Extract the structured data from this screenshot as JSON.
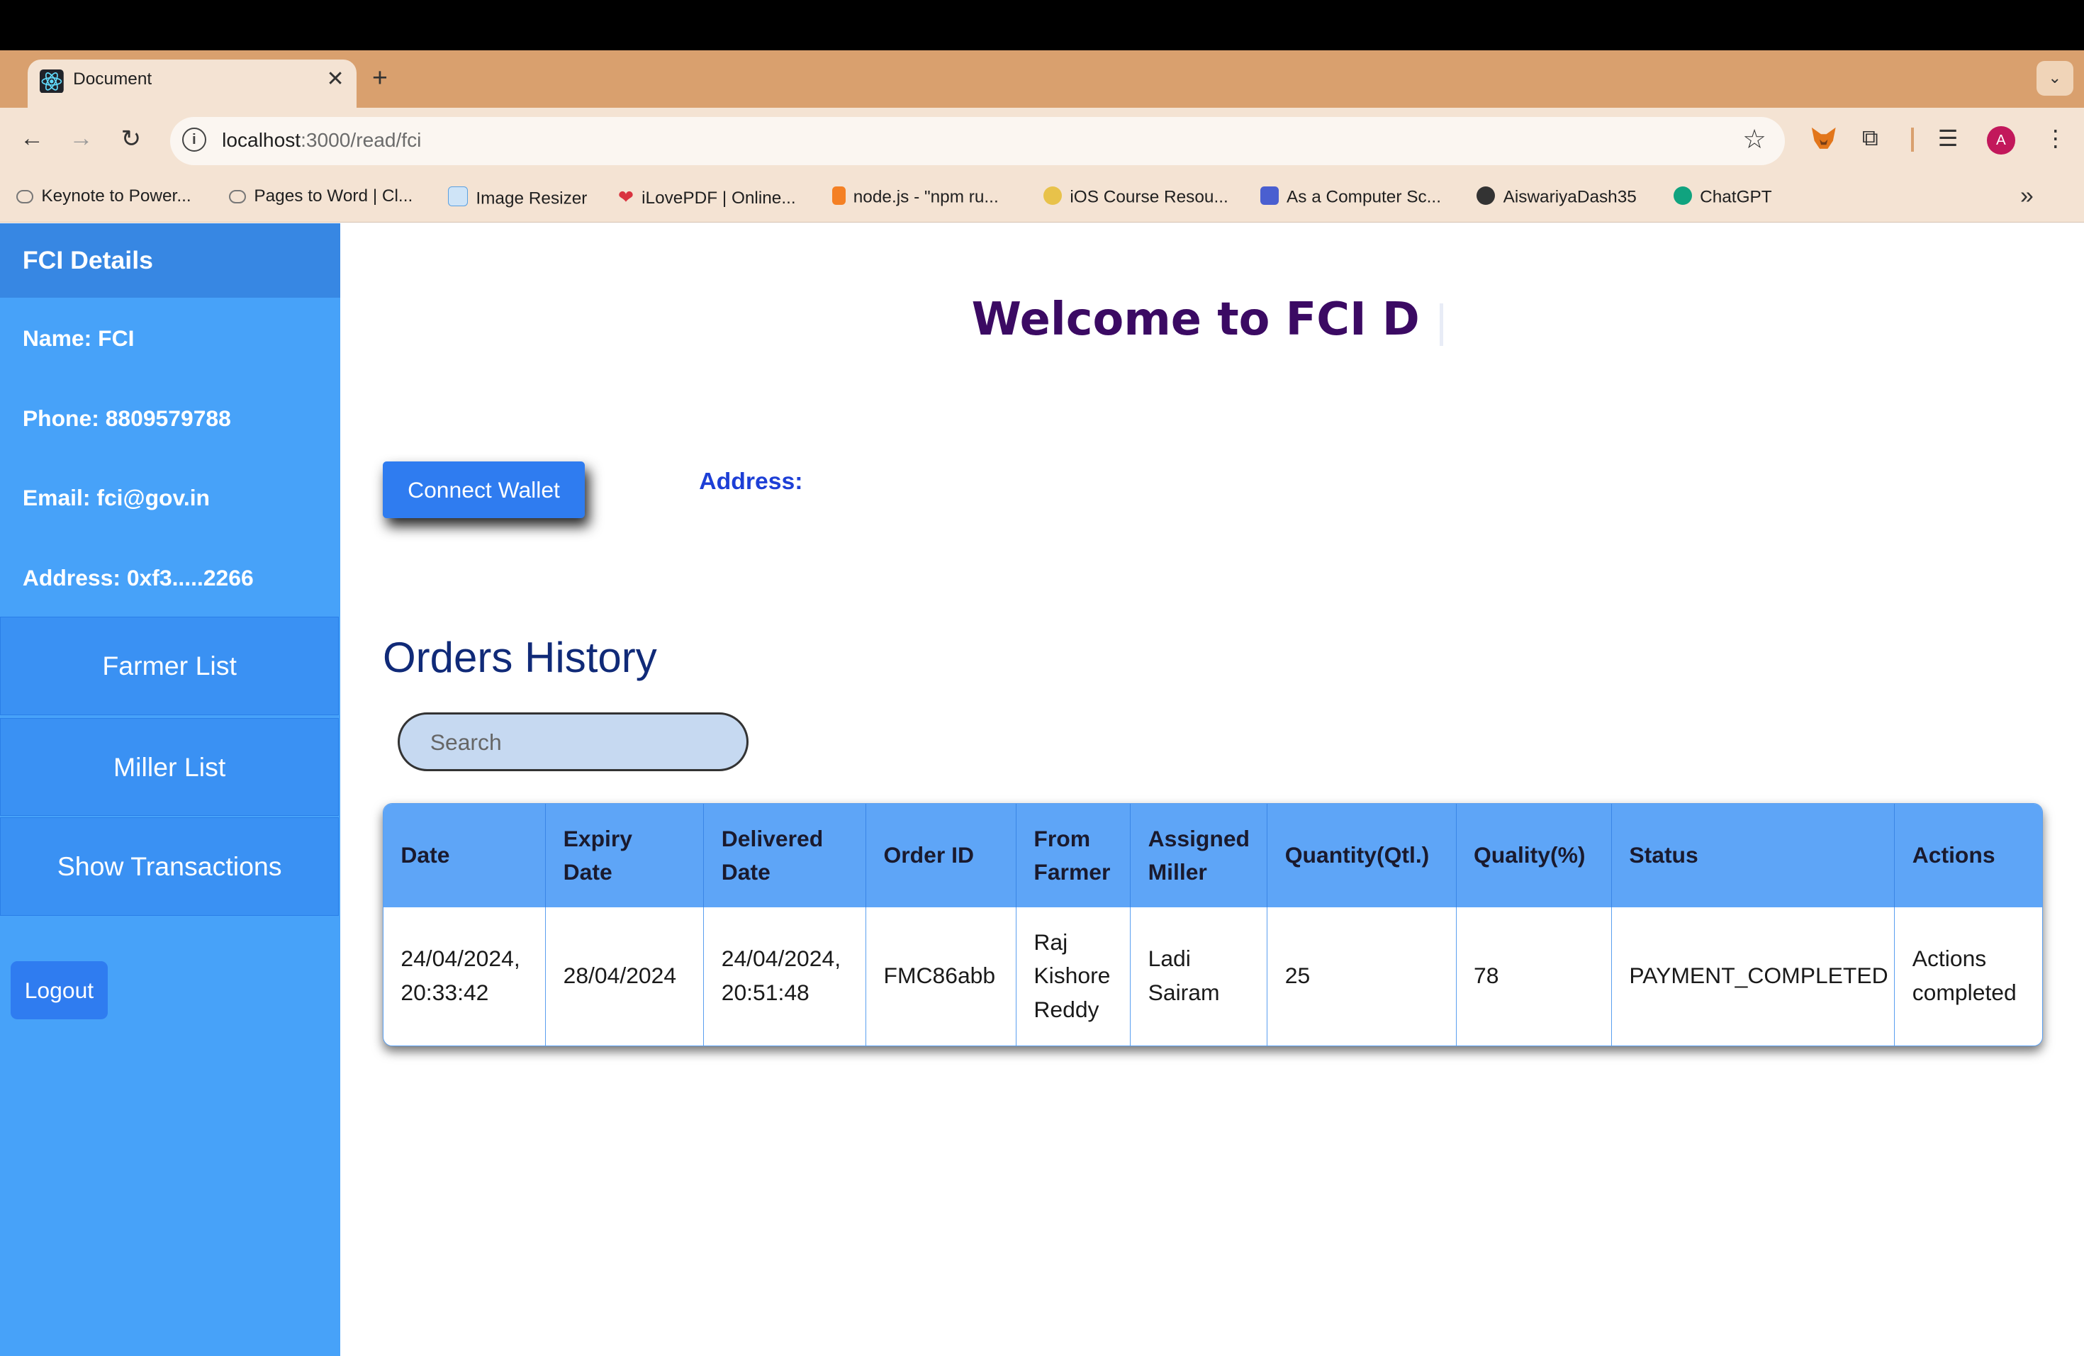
{
  "browser": {
    "tab_title": "Document",
    "url_host": "localhost",
    "url_rest": ":3000/read/fci",
    "profile_initial": "A",
    "bookmarks": [
      {
        "label": "Keynote to Power...",
        "color": "#888888"
      },
      {
        "label": "Pages to Word | Cl...",
        "color": "#888888"
      },
      {
        "label": "Image Resizer",
        "color": "#5aa0e0"
      },
      {
        "label": "iLovePDF | Online...",
        "color": "#d9333f"
      },
      {
        "label": "node.js - \"npm ru...",
        "color": "#f48024"
      },
      {
        "label": "iOS Course Resou...",
        "color": "#e8c24a"
      },
      {
        "label": "As a Computer Sc...",
        "color": "#4a5fd0"
      },
      {
        "label": "AiswariyaDash35",
        "color": "#333333"
      },
      {
        "label": "ChatGPT",
        "color": "#10a37f"
      }
    ]
  },
  "sidebar": {
    "title": "FCI Details",
    "name": "Name: FCI",
    "phone": "Phone: 8809579788",
    "email": "Email: fci@gov.in",
    "address": "Address: 0xf3.....2266",
    "buttons": {
      "farmer_list": "Farmer List",
      "miller_list": "Miller List",
      "show_transactions": "Show Transactions"
    },
    "logout": "Logout"
  },
  "main": {
    "welcome": "Welcome to FCI D",
    "connect_wallet": "Connect Wallet",
    "address_label": "Address:",
    "orders_title": "Orders History",
    "search_placeholder": "Search",
    "table": {
      "headers": [
        "Date",
        "Expiry Date",
        "Delivered Date",
        "Order ID",
        "From Farmer",
        "Assigned Miller",
        "Quantity(Qtl.)",
        "Quality(%)",
        "Status",
        "Actions"
      ],
      "rows": [
        [
          "24/04/2024, 20:33:42",
          "28/04/2024",
          "24/04/2024, 20:51:48",
          "FMC86abb",
          "Raj Kishore Reddy",
          "Ladi Sairam",
          "25",
          "78",
          "PAYMENT_COMPLETED",
          "Actions completed"
        ]
      ]
    }
  },
  "colors": {
    "sidebar_bg": "#47a2f9",
    "sidebar_header": "#3787e3",
    "primary_button": "#2f7cf0",
    "welcome_text": "#3b0a63",
    "table_header": "#5ea5f7"
  }
}
